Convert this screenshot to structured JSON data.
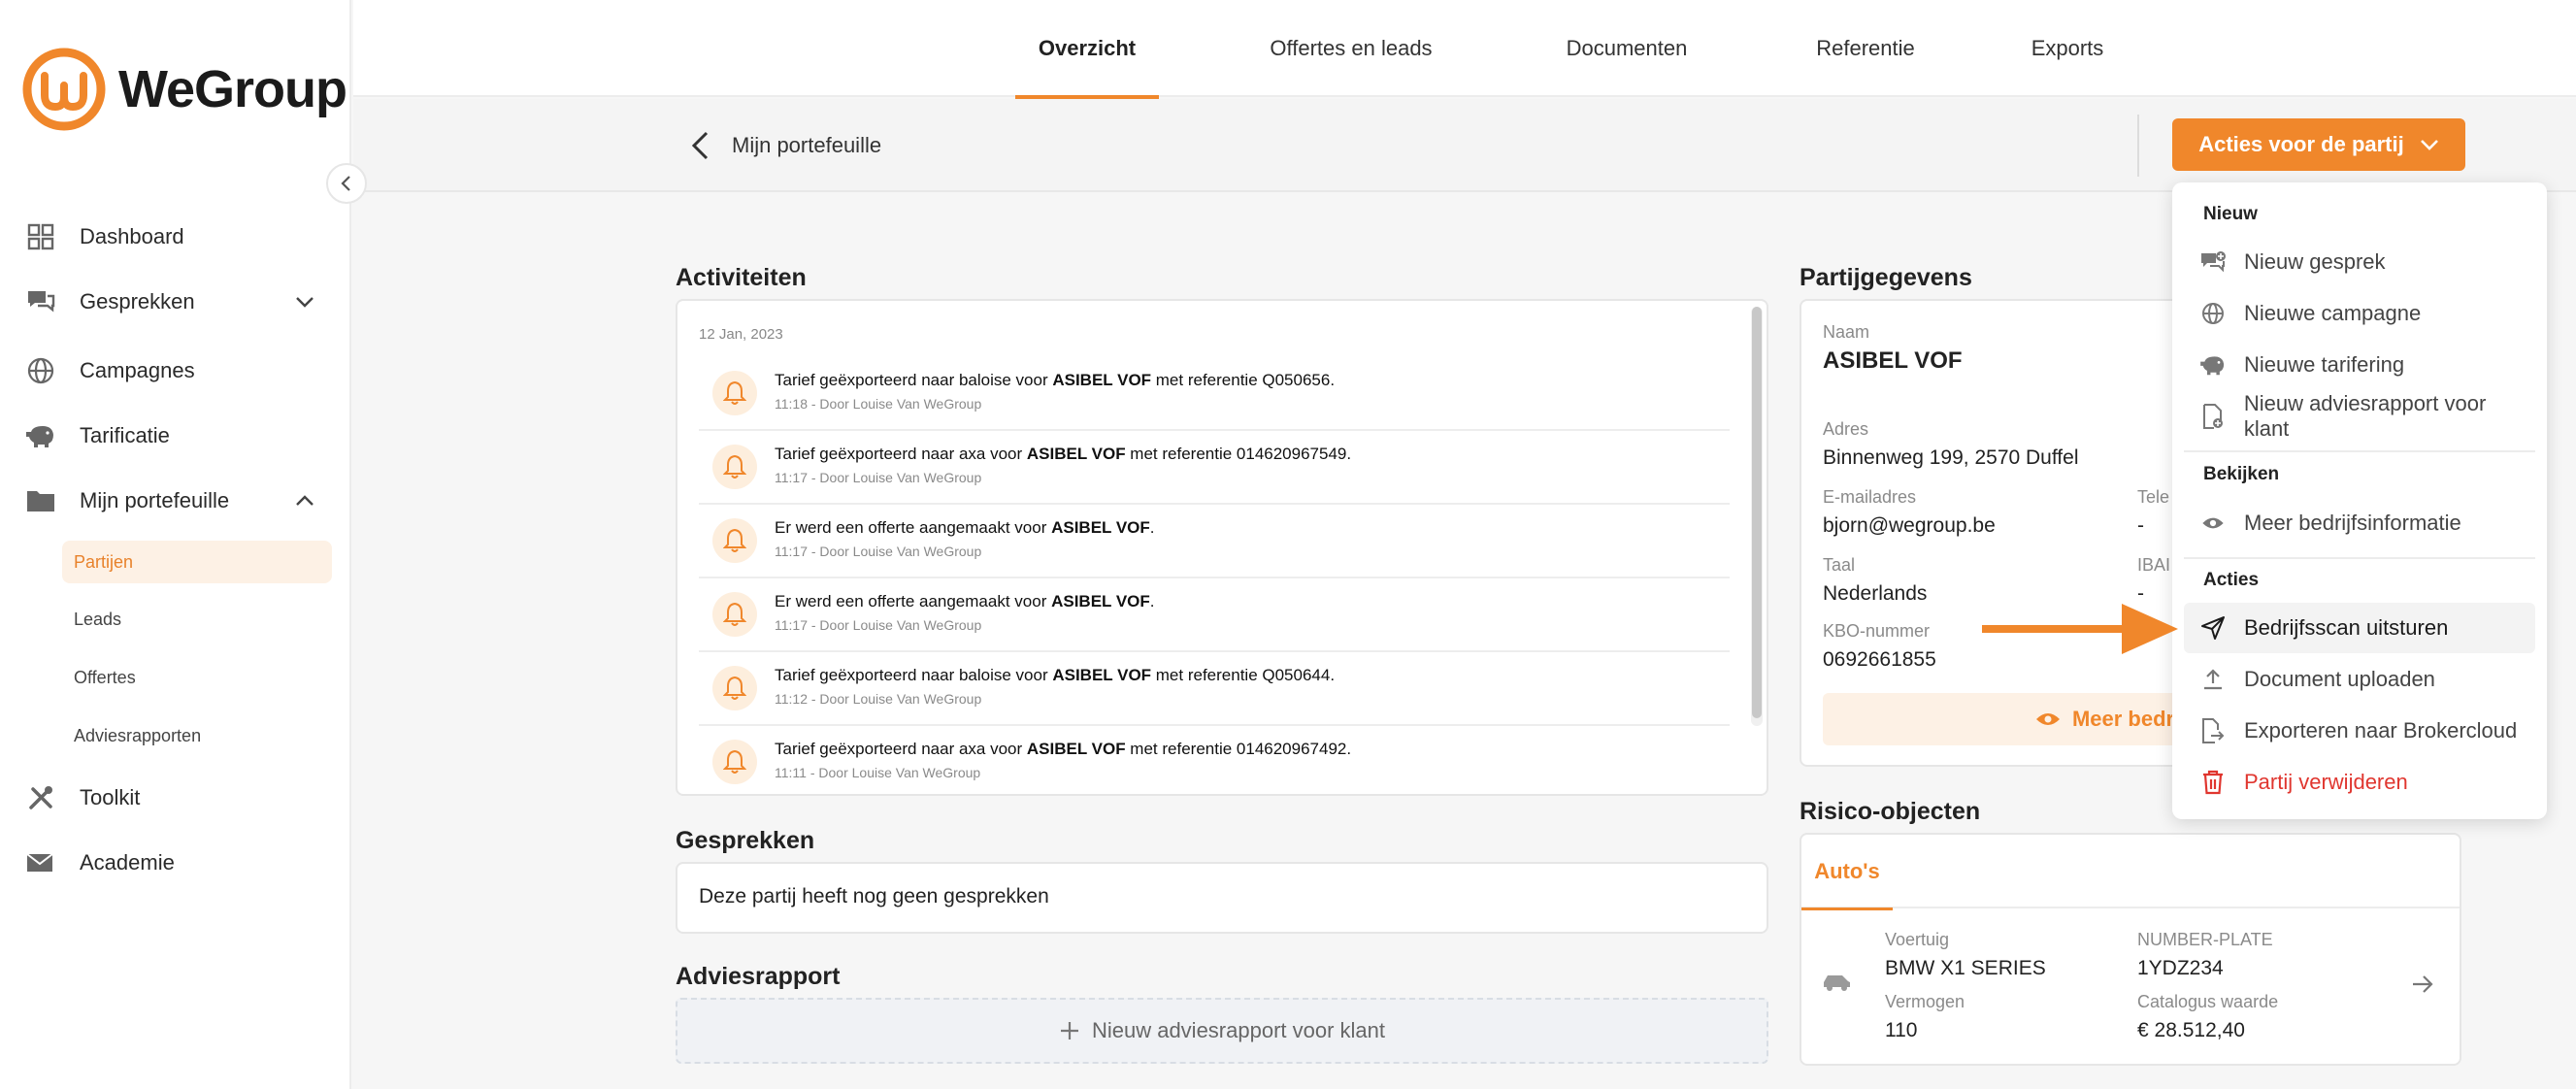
{
  "brand": {
    "name": "WeGroup",
    "accent": "#f0872b"
  },
  "sidebar": {
    "items": [
      {
        "label": "Dashboard",
        "icon": "grid-icon"
      },
      {
        "label": "Gesprekken",
        "icon": "chat-icon"
      },
      {
        "label": "Campagnes",
        "icon": "globe-icon"
      },
      {
        "label": "Tarificatie",
        "icon": "piggy-bank-icon"
      },
      {
        "label": "Mijn portefeuille",
        "icon": "folder-icon"
      },
      {
        "label": "Toolkit",
        "icon": "tools-icon"
      },
      {
        "label": "Academie",
        "icon": "mail-icon"
      }
    ],
    "sub_items": [
      "Partijen",
      "Leads",
      "Offertes",
      "Adviesrapporten"
    ]
  },
  "tabs": [
    "Overzicht",
    "Offertes en leads",
    "Documenten",
    "Referentie",
    "Exports"
  ],
  "subheader": {
    "back_label": "Mijn portefeuille",
    "actions_label": "Acties voor de partij"
  },
  "activities": {
    "title": "Activiteiten",
    "date": "12 Jan, 2023",
    "rows": [
      {
        "pre": "Tarief geëxporteerd naar baloise voor ",
        "bold": "ASIBEL VOF",
        "post": " met referentie Q050656.",
        "meta": "11:18 - Door Louise Van WeGroup"
      },
      {
        "pre": "Tarief geëxporteerd naar axa voor ",
        "bold": "ASIBEL VOF",
        "post": " met referentie 014620967549.",
        "meta": "11:17 - Door Louise Van WeGroup"
      },
      {
        "pre": "Er werd een offerte aangemaakt voor ",
        "bold": "ASIBEL VOF",
        "post": ".",
        "meta": "11:17 - Door Louise Van WeGroup"
      },
      {
        "pre": "Er werd een offerte aangemaakt voor ",
        "bold": "ASIBEL VOF",
        "post": ".",
        "meta": "11:17 - Door Louise Van WeGroup"
      },
      {
        "pre": "Tarief geëxporteerd naar baloise voor ",
        "bold": "ASIBEL VOF",
        "post": " met referentie Q050644.",
        "meta": "11:12 - Door Louise Van WeGroup"
      },
      {
        "pre": "Tarief geëxporteerd naar axa voor ",
        "bold": "ASIBEL VOF",
        "post": " met referentie 014620967492.",
        "meta": "11:11 - Door Louise Van WeGroup"
      }
    ]
  },
  "conversations": {
    "title": "Gesprekken",
    "empty": "Deze partij heeft nog geen gesprekken"
  },
  "advice": {
    "title": "Adviesrapport",
    "new_label": "Nieuw adviesrapport voor klant"
  },
  "party": {
    "title": "Partijgegevens",
    "name_label": "Naam",
    "name": "ASIBEL VOF",
    "address_label": "Adres",
    "address": "Binnenweg 199, 2570 Duffel",
    "email_label": "E-mailadres",
    "email": "bjorn@wegroup.be",
    "phone_label": "Tele",
    "phone": "-",
    "lang_label": "Taal",
    "lang": "Nederlands",
    "iban_label": "IBAI",
    "iban": "-",
    "kbo_label": "KBO-nummer",
    "kbo": "0692661855",
    "more_label": "Meer bedrijfsi"
  },
  "dropdown": {
    "sections": [
      {
        "header": "Nieuw",
        "items": [
          {
            "label": "Nieuw gesprek",
            "icon": "chat-plus-icon"
          },
          {
            "label": "Nieuwe campagne",
            "icon": "globe-icon"
          },
          {
            "label": "Nieuwe tarifering",
            "icon": "piggy-bank-icon"
          },
          {
            "label": "Nieuw adviesrapport voor klant",
            "icon": "document-plus-icon"
          }
        ]
      },
      {
        "header": "Bekijken",
        "items": [
          {
            "label": "Meer bedrijfsinformatie",
            "icon": "eye-icon"
          }
        ]
      },
      {
        "header": "Acties",
        "items": [
          {
            "label": "Bedrijfsscan uitsturen",
            "icon": "send-icon"
          },
          {
            "label": "Document uploaden",
            "icon": "upload-icon"
          },
          {
            "label": "Exporteren naar Brokercloud",
            "icon": "export-icon"
          },
          {
            "label": "Partij verwijderen",
            "icon": "trash-icon"
          }
        ]
      }
    ]
  },
  "risk": {
    "title": "Risico-objecten",
    "tab": "Auto's",
    "vehicle_label": "Voertuig",
    "vehicle": "BMW X1 SERIES",
    "plate_label": "NUMBER-PLATE",
    "plate": "1YDZ234",
    "power_label": "Vermogen",
    "power": "110",
    "catalog_label": "Catalogus waarde",
    "catalog": "€ 28.512,40"
  }
}
